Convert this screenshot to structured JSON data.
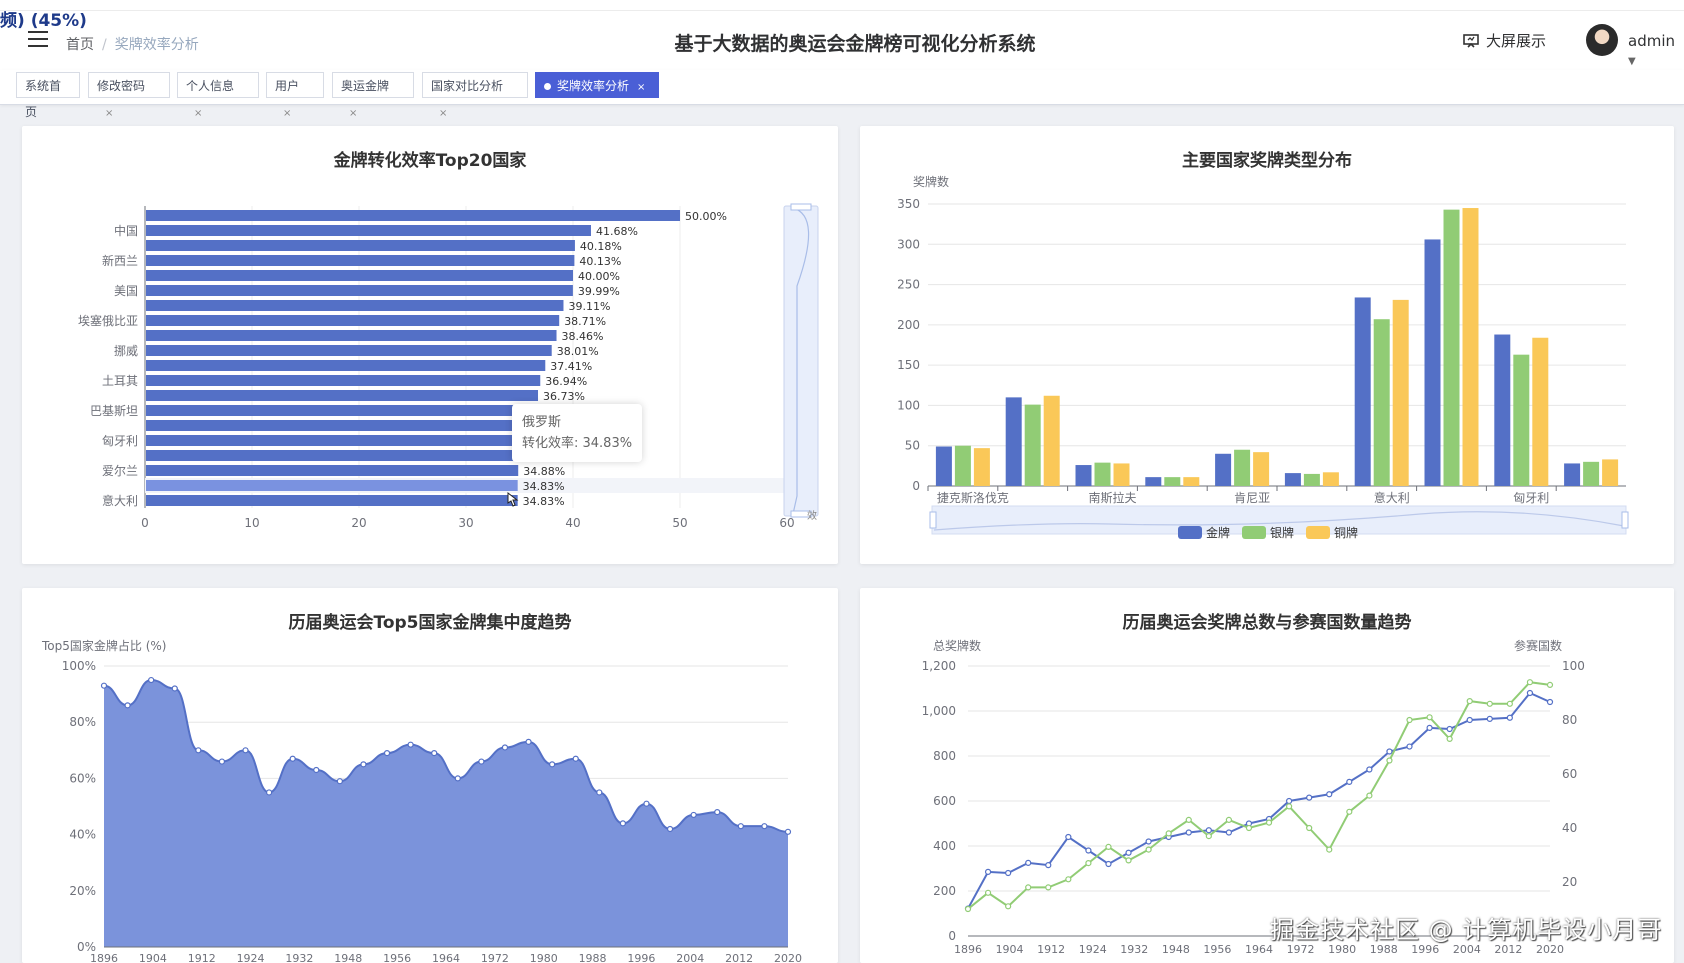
{
  "overlay_text": "频) (45%)",
  "breadcrumb": {
    "home": "首页",
    "current": "奖牌效率分析"
  },
  "app_title": "基于大数据的奥运会金牌榜可视化分析系统",
  "header": {
    "bigscreen_label": "大屏展示",
    "user": "admin"
  },
  "tabs": [
    {
      "label": "系统首页",
      "closable": false,
      "active": false
    },
    {
      "label": "修改密码",
      "closable": true,
      "active": false
    },
    {
      "label": "个人信息",
      "closable": true,
      "active": false
    },
    {
      "label": "用户",
      "closable": true,
      "active": false
    },
    {
      "label": "奥运金牌",
      "closable": true,
      "active": false
    },
    {
      "label": "国家对比分析",
      "closable": true,
      "active": false
    },
    {
      "label": "奖牌效率分析",
      "closable": true,
      "active": true
    }
  ],
  "tab_close_glyph": "×",
  "colors": {
    "accent": "#4a5fd6",
    "gold": "#5470c6",
    "silver": "#91cc75",
    "bronze": "#fac858",
    "area": "#7b93db"
  },
  "tooltip": {
    "country": "俄罗斯",
    "label": "转化效率: 34.83%"
  },
  "watermark": "掘金技术社区 @ 计算机毕设小月哥",
  "chart_data": [
    {
      "type": "bar",
      "orientation": "horizontal",
      "title": "金牌转化效率Top20国家",
      "categories_visible": [
        "意大利",
        "爱尔兰",
        "匈牙利",
        "巴基斯坦",
        "土耳其",
        "挪威",
        "埃塞俄比亚",
        "美国",
        "新西兰",
        "中国"
      ],
      "values": [
        34.83,
        34.83,
        34.88,
        null,
        null,
        null,
        null,
        36.73,
        36.94,
        37.41,
        38.01,
        38.46,
        38.71,
        39.11,
        39.99,
        40.0,
        40.13,
        40.18,
        41.68,
        50.0
      ],
      "data_labels": [
        "34.83%",
        "34.83%",
        "34.88%",
        "",
        "",
        "",
        "",
        "36.73%",
        "36.94%",
        "37.41%",
        "38.01%",
        "38.46%",
        "38.71%",
        "39.11%",
        "39.99%",
        "40.00%",
        "40.13%",
        "40.18%",
        "41.68%",
        "50.00%"
      ],
      "xlim": [
        0,
        60
      ],
      "xticks": [
        "0",
        "10",
        "20",
        "30",
        "40",
        "50",
        "60"
      ],
      "highlighted_index": 1,
      "datazoom_label": "效"
    },
    {
      "type": "bar",
      "title": "主要国家奖牌类型分布",
      "ylabel": "奖牌数",
      "ylim": [
        0,
        350
      ],
      "yticks": [
        "0",
        "50",
        "100",
        "150",
        "200",
        "250",
        "300",
        "350"
      ],
      "categories_labels": [
        "捷克斯洛伐克",
        "南斯拉夫",
        "肯尼亚",
        "意大利",
        "匈牙利"
      ],
      "series": [
        {
          "name": "金牌",
          "values": [
            49,
            110,
            26,
            11,
            40,
            16,
            234,
            306,
            188,
            28
          ]
        },
        {
          "name": "银牌",
          "values": [
            50,
            101,
            29,
            11,
            45,
            15,
            207,
            343,
            163,
            30
          ]
        },
        {
          "name": "铜牌",
          "values": [
            47,
            112,
            28,
            11,
            42,
            17,
            231,
            345,
            184,
            33
          ]
        }
      ]
    },
    {
      "type": "area",
      "title": "历届奥运会Top5国家金牌集中度趋势",
      "ylabel": "Top5国家金牌占比 (%)",
      "ylim": [
        0,
        100
      ],
      "yticks": [
        "0%",
        "20%",
        "40%",
        "60%",
        "80%",
        "100%"
      ],
      "xticks": [
        "1896",
        "1904",
        "1912",
        "1924",
        "1932",
        "1948",
        "1956",
        "1964",
        "1972",
        "1980",
        "1988",
        "1996",
        "2004",
        "2012",
        "2020"
      ],
      "values": [
        93,
        86,
        95,
        92,
        70,
        66,
        70,
        55,
        67,
        63,
        59,
        65,
        69,
        72,
        69,
        60,
        66,
        71,
        73,
        65,
        67,
        55,
        44,
        51,
        42,
        47,
        48,
        43,
        43,
        41
      ]
    },
    {
      "type": "line",
      "title": "历届奥运会奖牌总数与参赛国数量趋势",
      "ylabel": "总奖牌数",
      "y2label": "参赛国数",
      "ylim": [
        0,
        1200
      ],
      "y2lim": [
        0,
        100
      ],
      "yticks": [
        "0",
        "200",
        "400",
        "600",
        "800",
        "1,000",
        "1,200"
      ],
      "y2ticks": [
        "20",
        "40",
        "60",
        "80",
        "100"
      ],
      "xticks": [
        "1896",
        "1904",
        "1912",
        "1924",
        "1932",
        "1948",
        "1956",
        "1964",
        "1972",
        "1980",
        "1988",
        "1996",
        "2004",
        "2012",
        "2020"
      ],
      "series": [
        {
          "name": "总奖牌数",
          "axis": "left",
          "values": [
            122,
            285,
            280,
            325,
            315,
            440,
            380,
            320,
            370,
            420,
            440,
            460,
            470,
            460,
            500,
            520,
            600,
            615,
            630,
            685,
            740,
            820,
            842,
            925,
            920,
            960,
            965,
            970,
            1080,
            1040
          ]
        },
        {
          "name": "参赛国数",
          "axis": "right",
          "values": [
            10,
            16,
            11,
            18,
            18,
            21,
            27,
            33,
            28,
            32,
            38,
            43,
            37,
            43,
            40,
            42,
            48,
            40,
            32,
            46,
            52,
            65,
            80,
            81,
            73,
            87,
            86,
            86,
            94,
            93
          ]
        }
      ]
    }
  ]
}
